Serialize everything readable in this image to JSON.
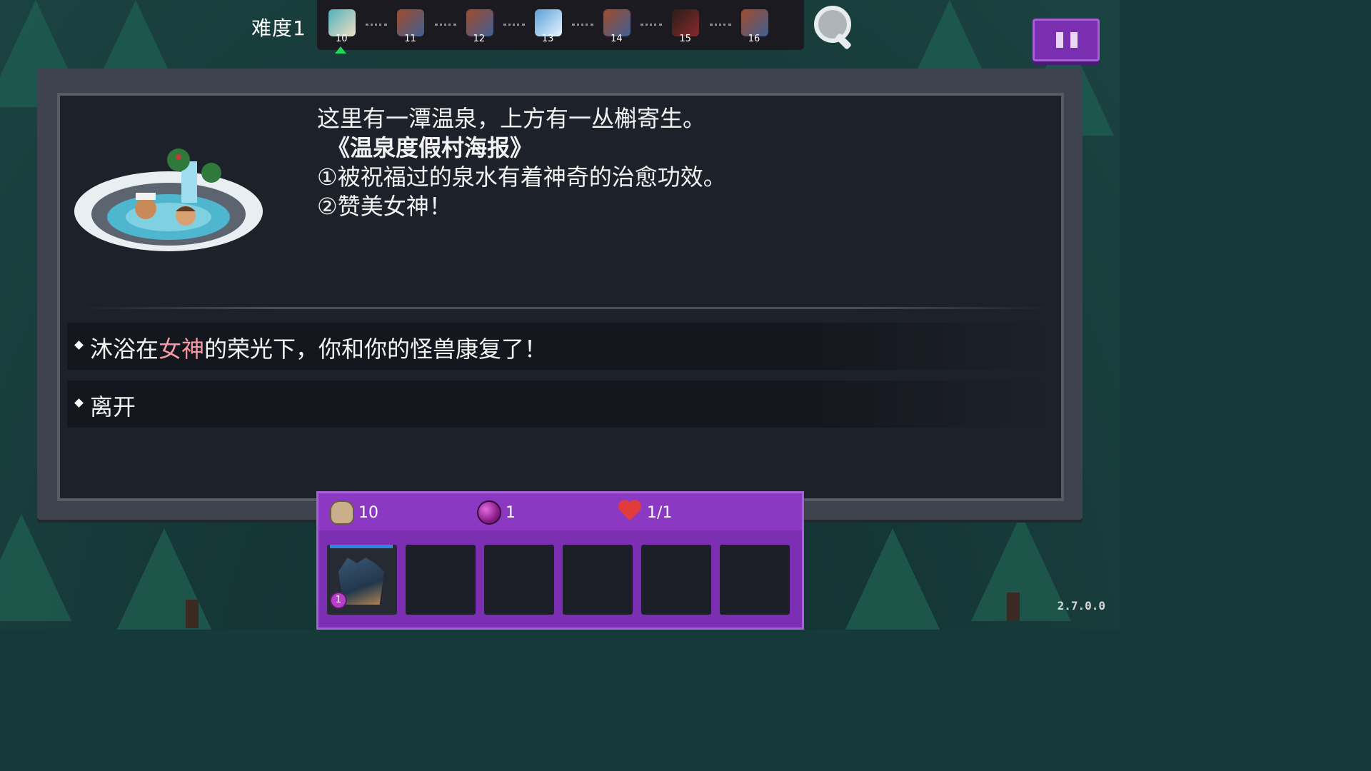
{
  "header": {
    "difficulty": "难度1",
    "stages": [
      {
        "num": "10",
        "type": "current",
        "icon": "hot-spring-icon"
      },
      {
        "num": "11",
        "type": "battle",
        "icon": "enemy-pair-icon"
      },
      {
        "num": "12",
        "type": "battle",
        "icon": "enemy-pair-icon"
      },
      {
        "num": "13",
        "type": "boss",
        "icon": "ghost-boss-icon"
      },
      {
        "num": "14",
        "type": "battle",
        "icon": "enemy-pair-icon"
      },
      {
        "num": "15",
        "type": "event",
        "icon": "bomb-creature-icon"
      },
      {
        "num": "16",
        "type": "battle",
        "icon": "enemy-pair-icon"
      }
    ],
    "search_icon": "magnifier-icon",
    "pause_icon": "pause-icon"
  },
  "event": {
    "image": "hot-spring-illustration",
    "lines": [
      "这里有一潭温泉，上方有一丛槲寄生。",
      "《温泉度假村海报》",
      "①被祝福过的泉水有着神奇的治愈功效。",
      "②赞美女神！"
    ],
    "options": [
      {
        "pre": "沐浴在",
        "highlight": "女神",
        "post": "的荣光下，你和你的怪兽康复了！"
      },
      {
        "pre": "离开",
        "highlight": "",
        "post": ""
      }
    ]
  },
  "inventory": {
    "gold": "10",
    "gems": "1",
    "health": "1/1",
    "slots": [
      {
        "filled": true,
        "level": "1",
        "xp_fraction": 0.9
      },
      {
        "filled": false
      },
      {
        "filled": false
      },
      {
        "filled": false
      },
      {
        "filled": false
      },
      {
        "filled": false
      }
    ]
  },
  "version": "2.7.0.0",
  "colors": {
    "highlight": "#f59aa6",
    "panel": "#3e434d",
    "inventory": "#7c2fb2",
    "current_marker": "#23d65a"
  }
}
